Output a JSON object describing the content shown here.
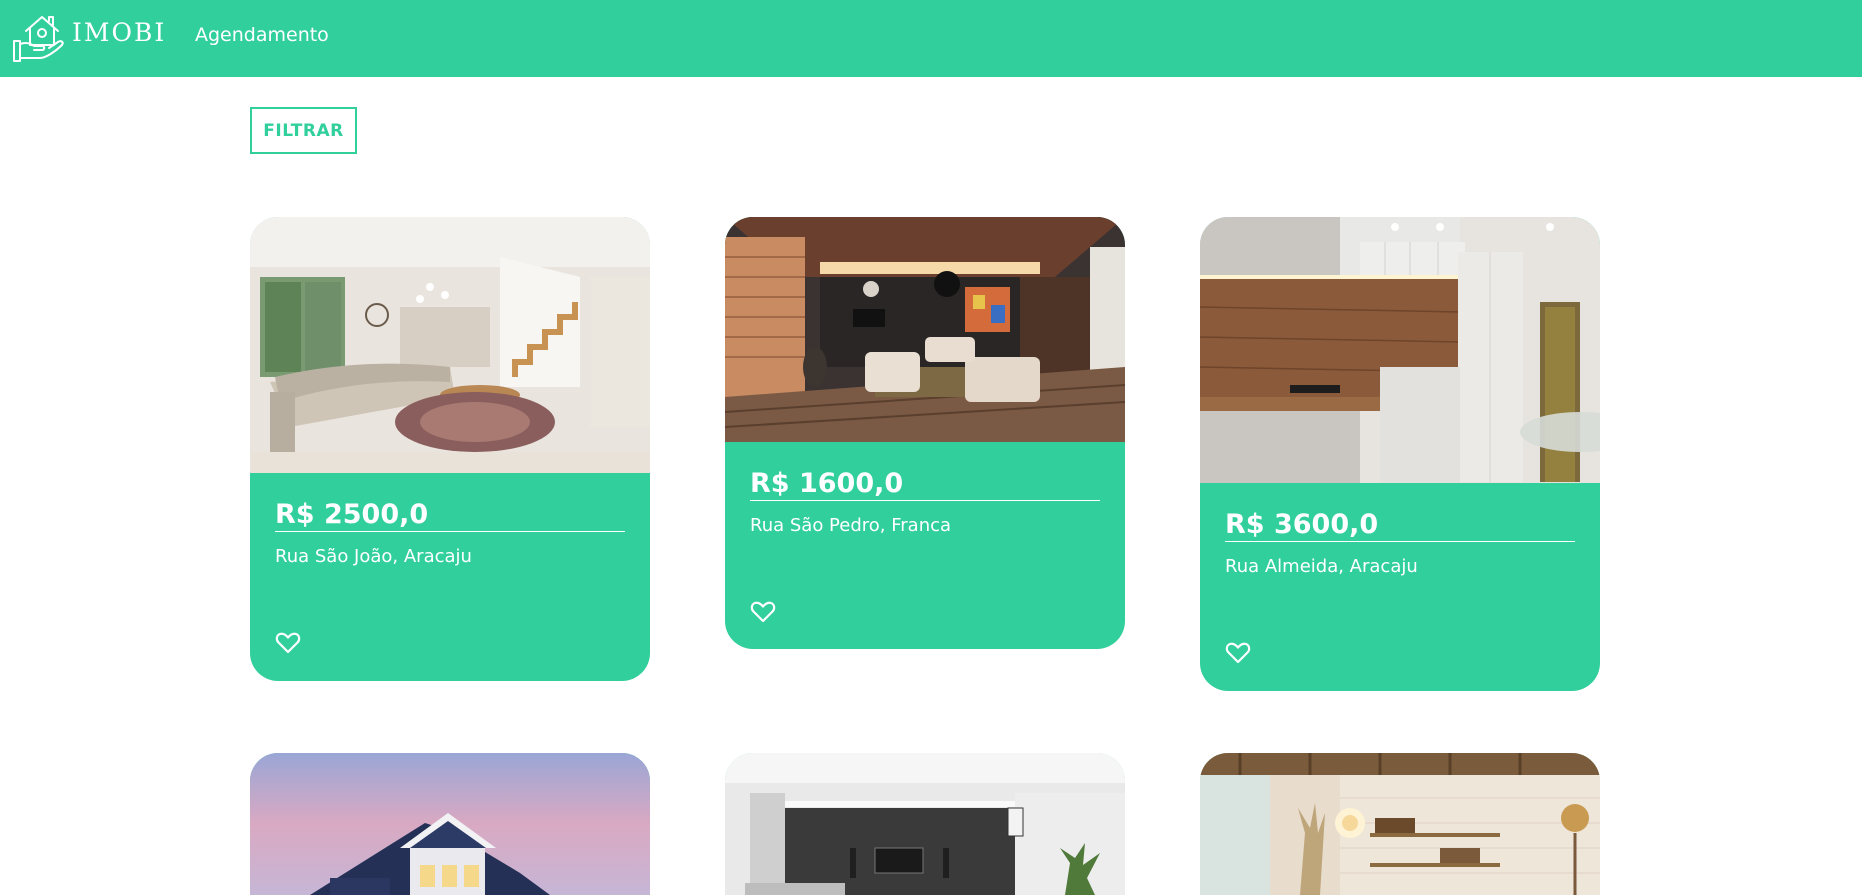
{
  "navbar": {
    "brand": "IMOBI",
    "brand_icon": "house-hand-logo-icon",
    "links": [
      "Agendamento"
    ],
    "color": "#31cf9c"
  },
  "filter": {
    "label": "FILTRAR"
  },
  "listings": [
    {
      "price": "R$ 2500,0",
      "address": "Rua São João, Aracaju",
      "favorite_icon": "heart-outline-icon"
    },
    {
      "price": "R$ 1600,0",
      "address": "Rua São Pedro, Franca",
      "favorite_icon": "heart-outline-icon"
    },
    {
      "price": "R$ 3600,0",
      "address": "Rua Almeida, Aracaju",
      "favorite_icon": "heart-outline-icon"
    },
    {
      "price": "",
      "address": "",
      "favorite_icon": "heart-outline-icon"
    },
    {
      "price": "",
      "address": "",
      "favorite_icon": "heart-outline-icon"
    },
    {
      "price": "",
      "address": "",
      "favorite_icon": "heart-outline-icon"
    }
  ],
  "colors": {
    "accent": "#31cf9c",
    "text_on_accent": "#ffffff",
    "background": "#ffffff"
  }
}
